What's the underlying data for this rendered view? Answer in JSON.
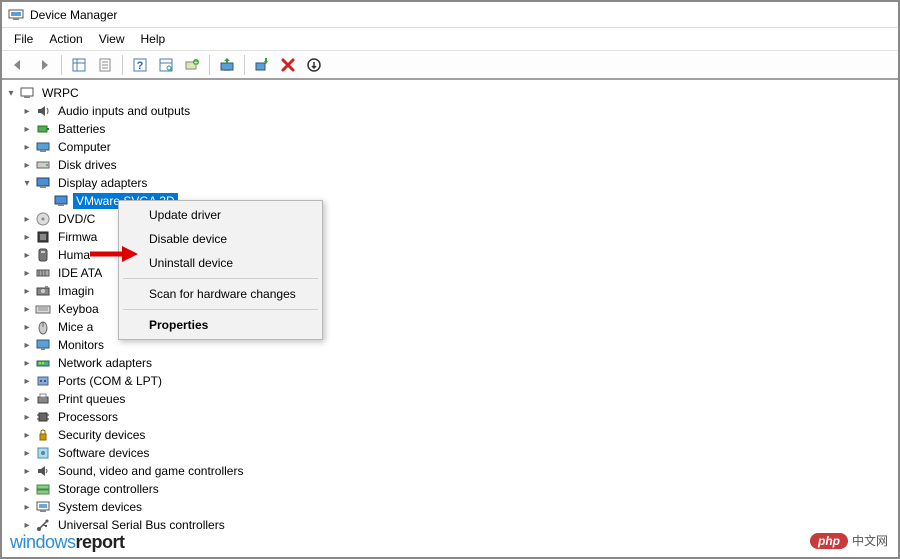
{
  "window": {
    "title": "Device Manager"
  },
  "menubar": [
    "File",
    "Action",
    "View",
    "Help"
  ],
  "root": {
    "label": "WRPC"
  },
  "categories": [
    {
      "label": "Audio inputs and outputs",
      "icon": "audio",
      "expanded": false
    },
    {
      "label": "Batteries",
      "icon": "battery",
      "expanded": false
    },
    {
      "label": "Computer",
      "icon": "computer",
      "expanded": false
    },
    {
      "label": "Disk drives",
      "icon": "disk",
      "expanded": false
    },
    {
      "label": "Display adapters",
      "icon": "display",
      "expanded": true,
      "children": [
        {
          "label": "VMware SVGA 3D",
          "icon": "display",
          "selected": true
        }
      ]
    },
    {
      "label": "DVD/C",
      "icon": "dvd",
      "expanded": false,
      "truncated": true
    },
    {
      "label": "Firmwa",
      "icon": "firmware",
      "expanded": false,
      "truncated": true
    },
    {
      "label": "Huma",
      "icon": "hid",
      "expanded": false,
      "truncated": true
    },
    {
      "label": "IDE ATA",
      "icon": "ide",
      "expanded": false,
      "truncated": true
    },
    {
      "label": "Imagin",
      "icon": "imaging",
      "expanded": false,
      "truncated": true
    },
    {
      "label": "Keyboa",
      "icon": "keyboard",
      "expanded": false,
      "truncated": true
    },
    {
      "label": "Mice a",
      "icon": "mouse",
      "expanded": false,
      "truncated": true
    },
    {
      "label": "Monitors",
      "icon": "monitor",
      "expanded": false
    },
    {
      "label": "Network adapters",
      "icon": "network",
      "expanded": false
    },
    {
      "label": "Ports (COM & LPT)",
      "icon": "port",
      "expanded": false
    },
    {
      "label": "Print queues",
      "icon": "printer",
      "expanded": false
    },
    {
      "label": "Processors",
      "icon": "cpu",
      "expanded": false
    },
    {
      "label": "Security devices",
      "icon": "security",
      "expanded": false
    },
    {
      "label": "Software devices",
      "icon": "software",
      "expanded": false
    },
    {
      "label": "Sound, video and game controllers",
      "icon": "sound",
      "expanded": false
    },
    {
      "label": "Storage controllers",
      "icon": "storage",
      "expanded": false
    },
    {
      "label": "System devices",
      "icon": "system",
      "expanded": false
    },
    {
      "label": "Universal Serial Bus controllers",
      "icon": "usb",
      "expanded": false
    }
  ],
  "context_menu": {
    "items": [
      {
        "label": "Update driver",
        "type": "item"
      },
      {
        "label": "Disable device",
        "type": "item"
      },
      {
        "label": "Uninstall device",
        "type": "item",
        "highlighted_by_arrow": true
      },
      {
        "type": "sep"
      },
      {
        "label": "Scan for hardware changes",
        "type": "item"
      },
      {
        "type": "sep"
      },
      {
        "label": "Properties",
        "type": "item",
        "bold": true
      }
    ]
  },
  "watermarks": {
    "left1": "windows",
    "left2": "report",
    "right_pill": "php",
    "right_txt": "中文网"
  }
}
